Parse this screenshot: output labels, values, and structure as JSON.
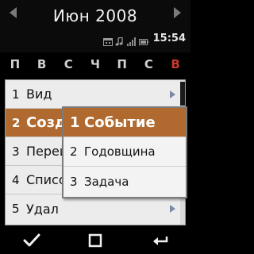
{
  "header": {
    "title": "Июн 2008",
    "time": "15:54"
  },
  "status_icons": [
    "calendar-icon",
    "music-note-icon",
    "signal-icon",
    "battery-icon"
  ],
  "weekdays": [
    "П",
    "В",
    "С",
    "Ч",
    "П",
    "С",
    "В"
  ],
  "menu": {
    "items": [
      {
        "number": "1",
        "label": "Вид",
        "has_submenu": true,
        "selected": false
      },
      {
        "number": "2",
        "label": "Созд",
        "has_submenu": true,
        "selected": true
      },
      {
        "number": "3",
        "label": "Перей",
        "has_submenu": false,
        "selected": false
      },
      {
        "number": "4",
        "label": "Списо",
        "has_submenu": false,
        "selected": false
      },
      {
        "number": "5",
        "label": "Удал",
        "has_submenu": true,
        "selected": false
      }
    ]
  },
  "submenu": {
    "items": [
      {
        "number": "1",
        "label": "Событие",
        "selected": true
      },
      {
        "number": "2",
        "label": "Годовщина",
        "selected": false
      },
      {
        "number": "3",
        "label": "Задача",
        "selected": false
      }
    ]
  },
  "softkeys": [
    "check-icon",
    "square-icon",
    "back-icon"
  ],
  "colors": {
    "accent": "#b06a30",
    "sunday": "#c83a2c",
    "menu_bg": "#ececec"
  }
}
